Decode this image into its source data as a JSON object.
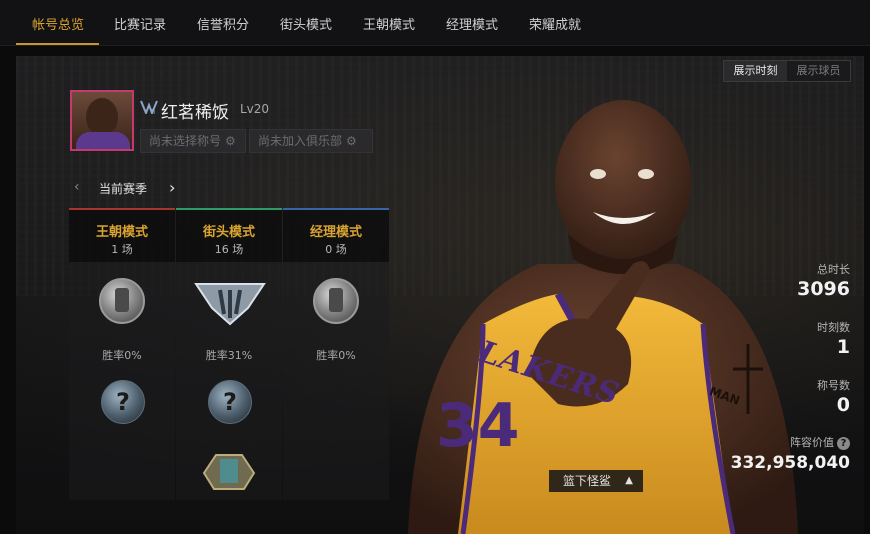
{
  "tabs": [
    {
      "label": "帐号总览",
      "active": true
    },
    {
      "label": "比赛记录",
      "active": false
    },
    {
      "label": "信誉积分",
      "active": false
    },
    {
      "label": "街头模式",
      "active": false
    },
    {
      "label": "王朝模式",
      "active": false
    },
    {
      "label": "经理模式",
      "active": false
    },
    {
      "label": "荣耀成就",
      "active": false
    }
  ],
  "toggle": {
    "on_label": "展示时刻",
    "off_label": "展示球员"
  },
  "profile": {
    "rank_badge": "II",
    "username": "红茗稀饭",
    "level": "Lv20",
    "title_chip": "尚未选择称号",
    "club_chip": "尚未加入俱乐部"
  },
  "season": {
    "label": "当前赛季"
  },
  "modes": [
    {
      "name": "王朝模式",
      "count": "1 场",
      "winrate": "胜率0%",
      "color": "#d9a431"
    },
    {
      "name": "街头模式",
      "count": "16 场",
      "winrate": "胜率31%",
      "color": "#2f9a68"
    },
    {
      "name": "经理模式",
      "count": "0 场",
      "winrate": "胜率0%",
      "color": "#d9a431"
    }
  ],
  "mode_line_colors": [
    "#a8352d",
    "#2f9a68",
    "#3a64a8"
  ],
  "stats": {
    "playtime_label": "总时长",
    "playtime_value": "3096",
    "moments_label": "时刻数",
    "moments_value": "1",
    "titles_label": "称号数",
    "titles_value": "0",
    "lineup_label": "阵容价值",
    "lineup_value": "332,958,040"
  },
  "player": {
    "name": "篮下怪鲨",
    "jersey_number": "34",
    "jersey_text": "LAKERS",
    "tattoo_text": "MAN"
  },
  "mystery_symbol": "?",
  "icons": {
    "prev": "chevron-left-icon",
    "next": "chevron-right-icon",
    "gear": "gear-icon",
    "help": "help-icon",
    "caret": "caret-up-icon"
  }
}
